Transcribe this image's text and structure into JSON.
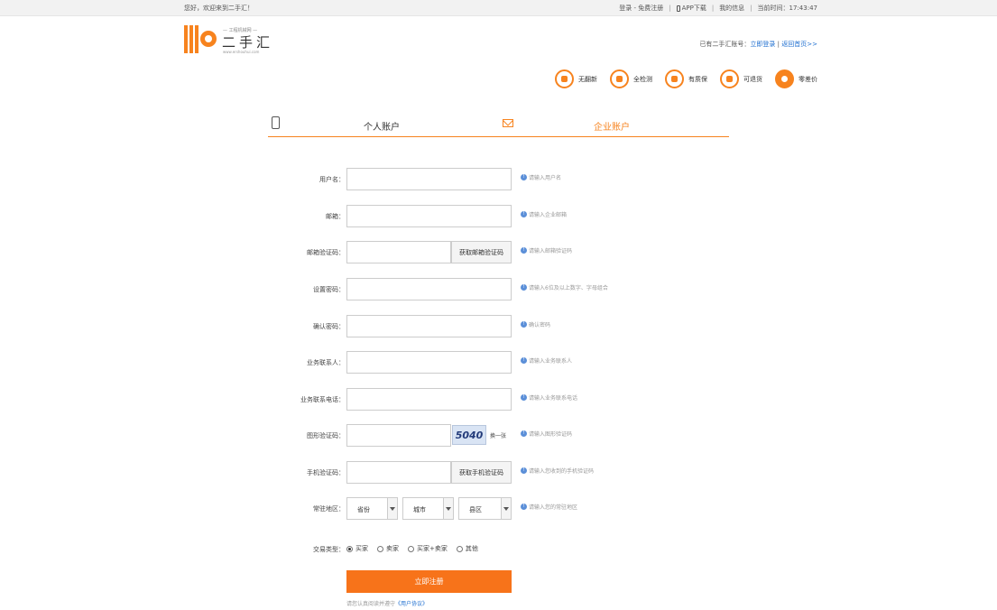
{
  "topbar": {
    "greeting": "您好，欢迎来到二手汇！",
    "login": "登录",
    "register": "免费注册",
    "app_download": "APP下载",
    "my_info": "我的信息",
    "time_label": "当前时间：17:43:47"
  },
  "logo": {
    "tagline": "— 工程机械网 —",
    "name": "二手汇",
    "url": "www.ershouhui.com"
  },
  "header": {
    "have_account": "已有二手汇账号：",
    "login_now": "立即登录",
    "separator": "|",
    "back_home": "返回首页>>"
  },
  "features": [
    {
      "label": "无翻新",
      "icon": "tools-icon"
    },
    {
      "label": "全检测",
      "icon": "inspect-icon"
    },
    {
      "label": "有质保",
      "icon": "warranty-icon"
    },
    {
      "label": "可退货",
      "icon": "return-icon"
    },
    {
      "label": "零差价",
      "icon": "money-bag-icon"
    }
  ],
  "tabs": {
    "personal": "个人账户",
    "business": "企业账户",
    "active": "business"
  },
  "form": {
    "username": {
      "label": "用户名：",
      "hint": "请输入用户名"
    },
    "email": {
      "label": "邮箱：",
      "hint": "请输入企业邮箱"
    },
    "email_code": {
      "label": "邮箱验证码：",
      "button": "获取邮箱验证码",
      "hint": "请输入邮箱验证码"
    },
    "password": {
      "label": "设置密码：",
      "hint": "请输入6位及以上数字、字母组合"
    },
    "confirm_password": {
      "label": "确认密码：",
      "hint": "确认密码"
    },
    "contact": {
      "label": "业务联系人：",
      "hint": "请输入业务联系人"
    },
    "contact_phone": {
      "label": "业务联系电话：",
      "hint": "请输入业务联系电话"
    },
    "captcha": {
      "label": "图形验证码：",
      "code": "5040",
      "change": "换一张",
      "hint": "请输入图形验证码"
    },
    "sms_code": {
      "label": "手机验证码：",
      "button": "获取手机验证码",
      "hint": "请输入您收到的手机验证码"
    },
    "region": {
      "label": "常驻地区：",
      "province": "省份",
      "city": "城市",
      "district": "县区",
      "hint": "请输入您的常驻地区"
    },
    "trade_type": {
      "label": "交易类型：",
      "options": [
        "买家",
        "卖家",
        "买家+卖家",
        "其他"
      ],
      "selected": "买家"
    },
    "submit": "立即注册",
    "agree_text": "请您认真阅读并遵守",
    "agreement_link": "《用户协议》"
  },
  "colors": {
    "accent": "#f7831e",
    "link": "#1f6fd0",
    "info": "#5b8fd8"
  }
}
